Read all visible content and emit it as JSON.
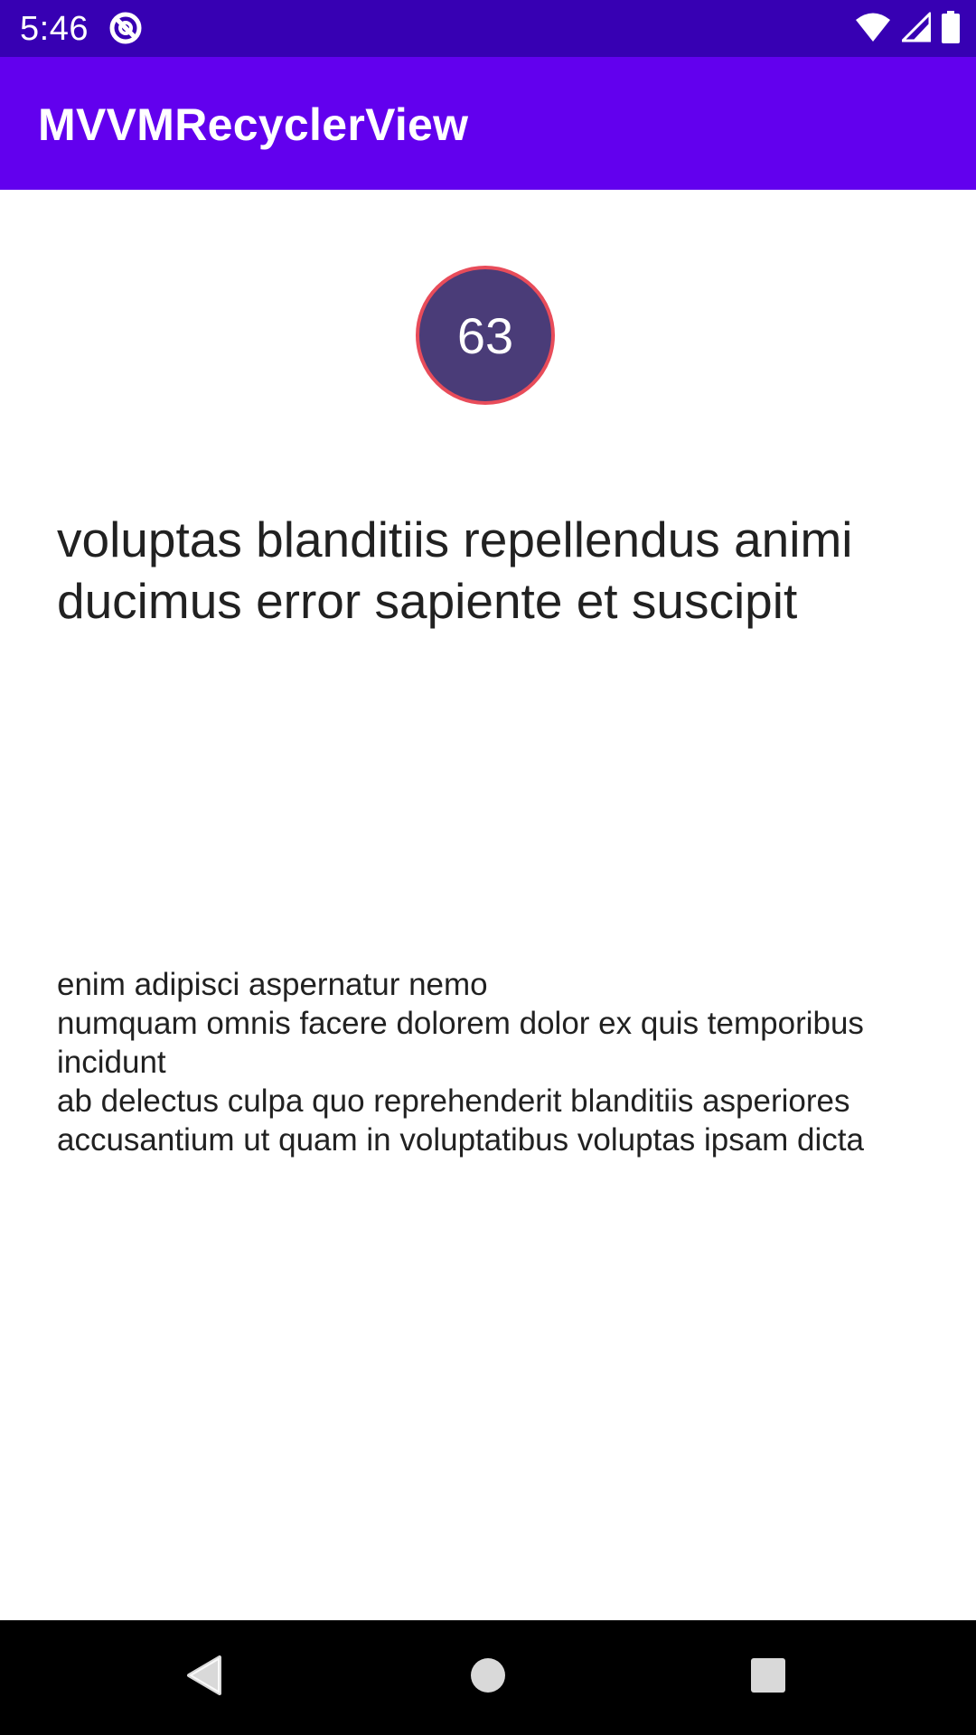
{
  "status_bar": {
    "time": "5:46",
    "icons": [
      "app-notification-icon",
      "wifi-icon",
      "cellular-signal-icon",
      "battery-icon"
    ]
  },
  "app_bar": {
    "title": "MVVMRecyclerView"
  },
  "post": {
    "id": "63",
    "title": "voluptas blanditiis repellendus animi ducimus error sapiente et suscipit",
    "body": "enim adipisci aspernatur nemo\nnumquam omnis facere dolorem dolor ex quis temporibus incidunt\nab delectus culpa quo reprehenderit blanditiis asperiores\naccusantium ut quam in voluptatibus voluptas ipsam dicta"
  },
  "nav_bar": {
    "icons": [
      "back-icon",
      "home-icon",
      "recents-icon"
    ]
  },
  "colors": {
    "status_bar": "#3700b3",
    "app_bar": "#6200ee",
    "badge_fill": "#4a3c78",
    "badge_border": "#e84c5a",
    "text": "#212121"
  }
}
